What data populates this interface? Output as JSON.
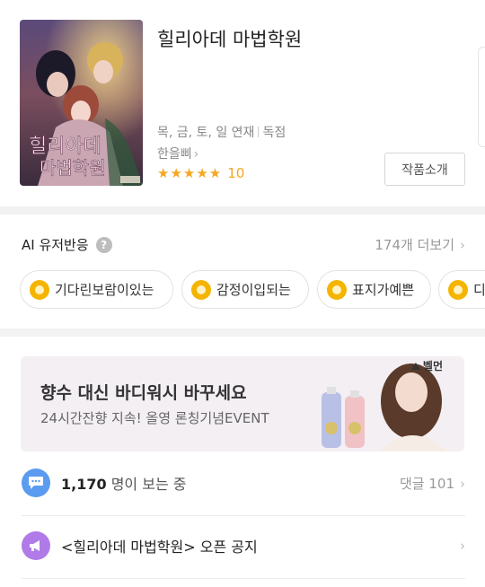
{
  "header": {
    "title": "힐리아데 마법학원",
    "schedule": [
      "목, 금, 토, 일 연재",
      "독점"
    ],
    "author": "한을삐",
    "stars": "★★★★★",
    "rating": "10",
    "intro_button": "작품소개",
    "cover_text": "힐리아데 마법학원"
  },
  "ai": {
    "title": "AI 유저반응",
    "help": "?",
    "more": "174개 더보기",
    "chips": [
      "기다린보람이있는",
      "감정이입되는",
      "표지가예쁜",
      "디"
    ]
  },
  "ad": {
    "brand": "벨먼",
    "headline": "향수 대신 바디워시 바꾸세요",
    "sub": "24시간잔향 지속! 올영 론칭기념EVENT"
  },
  "viewers": {
    "count": "1,170",
    "suffix": " 명이 보는 중",
    "comments": "댓글 101"
  },
  "notice": {
    "text": "<힐리아데 마법학원> 오픈 공지"
  },
  "colors": {
    "star": "#f5a623",
    "coin": "#f4b400",
    "viewer_icon": "#5b9bf0",
    "notice_icon": "#b07be8"
  },
  "icons": [
    "help-icon",
    "chevron-right-icon",
    "coin-icon",
    "chat-bubble-icon",
    "megaphone-icon"
  ]
}
